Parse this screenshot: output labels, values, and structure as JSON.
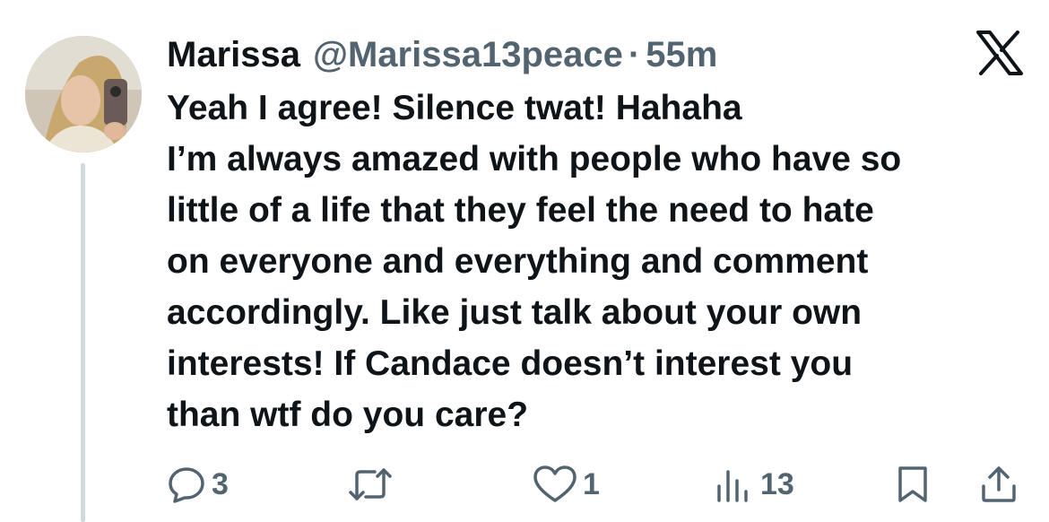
{
  "tweet": {
    "author_name": "Marissa",
    "handle": "@Marissa13peace",
    "separator": "·",
    "time": "55m",
    "lines": [
      "Yeah I agree! Silence twat! Hahaha",
      "I’m always amazed with people who have so",
      "little of a life that they feel the need to hate",
      "on everyone and everything and comment",
      "accordingly. Like just talk about your own",
      "interests! If Candace doesn’t interest you",
      "than wtf do you care?"
    ]
  },
  "actions": {
    "replies": "3",
    "likes": "1",
    "views": "13"
  },
  "icons": {
    "logo": "x-logo-icon",
    "reply": "reply-icon",
    "repost": "repost-icon",
    "like": "heart-icon",
    "views": "views-icon",
    "bookmark": "bookmark-icon",
    "share": "share-icon"
  },
  "colors": {
    "text": "#0f1419",
    "secondary": "#536471",
    "thread_line": "#cfd9de"
  }
}
